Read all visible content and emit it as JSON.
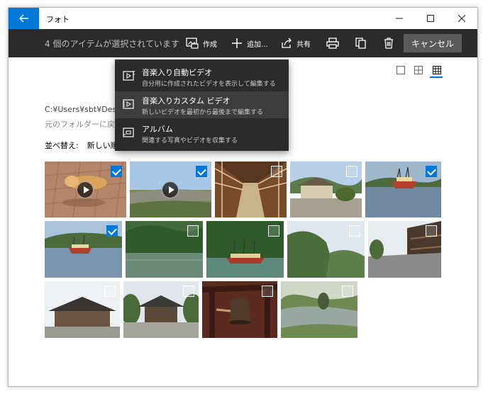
{
  "window": {
    "title": "フォト"
  },
  "window_controls": {
    "minimize": "−",
    "maximize": "☐",
    "close": "✕"
  },
  "toolbar": {
    "selection_text": "4 個のアイテムが選択されています",
    "create_label": "作成",
    "add_label": "追加...",
    "share_label": "共有",
    "cancel_label": "キャンセル"
  },
  "background": {
    "path": "C:¥Users¥sbt¥Des",
    "back_link": "元のフォルダーに戻る",
    "sort_label": "並べ替え:",
    "sort_value": "新しい順"
  },
  "menu": {
    "items": [
      {
        "title": "音楽入り自動ビデオ",
        "desc": "自分用に作成されたビデオを表示して編集する",
        "icon": "auto-video-icon"
      },
      {
        "title": "音楽入りカスタム ビデオ",
        "desc": "新しいビデオを最初から最後まで編集する",
        "icon": "custom-video-icon"
      },
      {
        "title": "アルバム",
        "desc": "関連する写真やビデオを収集する",
        "icon": "album-icon"
      }
    ],
    "highlighted_index": 1
  },
  "colors": {
    "accent": "#0078d7",
    "toolbar": "#2b2b2b",
    "menu": "#2b2b2b"
  },
  "photos": [
    {
      "subject": "dog lying on tiled ground",
      "selected": true,
      "video": true
    },
    {
      "subject": "hillside town view",
      "selected": true,
      "video": true
    },
    {
      "subject": "wooden corridor",
      "selected": false,
      "video": false
    },
    {
      "subject": "traditional building with garden",
      "selected": false,
      "video": false
    },
    {
      "subject": "pirate ship on lake",
      "selected": true,
      "video": false
    },
    {
      "subject": "pirate ship on lake with mountains",
      "selected": true,
      "video": false
    },
    {
      "subject": "lake with forested mountains",
      "selected": false,
      "video": false
    },
    {
      "subject": "pirate ship near forest",
      "selected": false,
      "video": false
    },
    {
      "subject": "green hillside",
      "selected": false,
      "video": false
    },
    {
      "subject": "old town street",
      "selected": false,
      "video": false
    },
    {
      "subject": "temple building",
      "selected": false,
      "video": false
    },
    {
      "subject": "temple hall",
      "selected": false,
      "video": false
    },
    {
      "subject": "temple bell",
      "selected": false,
      "video": false
    },
    {
      "subject": "japanese garden pond",
      "selected": false,
      "video": false
    }
  ]
}
